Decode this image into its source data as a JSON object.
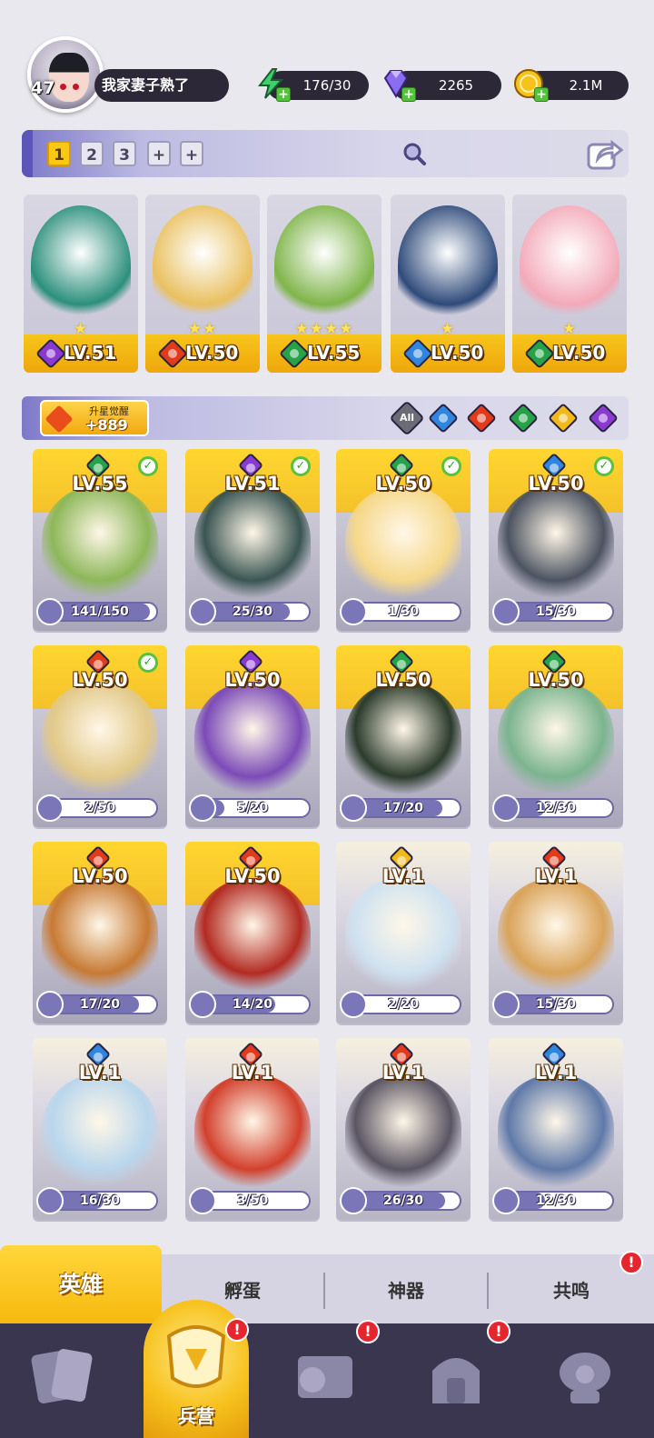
{
  "player": {
    "level": "47",
    "name": "我家妻子熟了"
  },
  "resources": {
    "energy": "176/30",
    "gems": "2265",
    "gold": "2.1M"
  },
  "team_tabs": [
    "1",
    "2",
    "3",
    "+",
    "+"
  ],
  "team": [
    {
      "level": "LV.51",
      "element": "dark",
      "stars": "★",
      "color": "#2b8f7c"
    },
    {
      "level": "LV.50",
      "element": "fire",
      "stars": "★★",
      "color": "#e9c060"
    },
    {
      "level": "LV.55",
      "element": "wind",
      "stars": "★★★★",
      "color": "#7fb54a"
    },
    {
      "level": "LV.50",
      "element": "water",
      "stars": "★",
      "color": "#2e4a7a"
    },
    {
      "level": "LV.50",
      "element": "wind",
      "stars": "★",
      "color": "#f3a9b8"
    }
  ],
  "awaken": {
    "title": "升星觉醒",
    "count": "+889"
  },
  "filter": {
    "all_label": "All",
    "elements": [
      "water",
      "fire",
      "wind",
      "light",
      "dark"
    ]
  },
  "heroes": [
    {
      "level": "LV.55",
      "element": "wind",
      "check": true,
      "progress": "141/150",
      "fill": 0.94,
      "color": "#8db759"
    },
    {
      "level": "LV.51",
      "element": "dark",
      "check": true,
      "progress": "25/30",
      "fill": 0.83,
      "color": "#3a5552"
    },
    {
      "level": "LV.50",
      "element": "wind",
      "check": true,
      "progress": "1/30",
      "fill": 0.03,
      "color": "#f6d88a"
    },
    {
      "level": "LV.50",
      "element": "water",
      "check": true,
      "progress": "15/30",
      "fill": 0.5,
      "color": "#4c5361"
    },
    {
      "level": "LV.50",
      "element": "fire",
      "check": true,
      "progress": "2/50",
      "fill": 0.04,
      "color": "#e2c989"
    },
    {
      "level": "LV.50",
      "element": "dark",
      "check": false,
      "progress": "5/20",
      "fill": 0.25,
      "color": "#7c4bb7"
    },
    {
      "level": "LV.50",
      "element": "wind",
      "check": false,
      "progress": "17/20",
      "fill": 0.85,
      "color": "#2b3b2c"
    },
    {
      "level": "LV.50",
      "element": "wind",
      "check": false,
      "progress": "12/30",
      "fill": 0.4,
      "color": "#7bb48e"
    },
    {
      "level": "LV.50",
      "element": "fire",
      "check": false,
      "progress": "17/20",
      "fill": 0.85,
      "color": "#c77a34"
    },
    {
      "level": "LV.50",
      "element": "fire",
      "check": false,
      "progress": "14/20",
      "fill": 0.7,
      "color": "#b32b22"
    },
    {
      "level": "LV.1",
      "element": "light",
      "check": false,
      "progress": "2/20",
      "fill": 0.1,
      "color": "#cfe2f0",
      "greyed": true
    },
    {
      "level": "LV.1",
      "element": "fire",
      "check": false,
      "progress": "15/30",
      "fill": 0.5,
      "color": "#d9a35a",
      "greyed": true
    },
    {
      "level": "LV.1",
      "element": "water",
      "check": false,
      "progress": "16/30",
      "fill": 0.53,
      "color": "#b9d6ec",
      "greyed": true
    },
    {
      "level": "LV.1",
      "element": "fire",
      "check": false,
      "progress": "3/50",
      "fill": 0.06,
      "color": "#d2402c",
      "greyed": true
    },
    {
      "level": "LV.1",
      "element": "fire",
      "check": false,
      "progress": "26/30",
      "fill": 0.87,
      "color": "#5a5563",
      "greyed": true
    },
    {
      "level": "LV.1",
      "element": "water",
      "check": false,
      "progress": "12/30",
      "fill": 0.4,
      "color": "#5f79a8",
      "greyed": true
    }
  ],
  "tabs": {
    "heroes": "英雄",
    "hatch": "孵蛋",
    "artifact": "神器",
    "resonance": "共鸣",
    "badge": "!"
  },
  "nav": {
    "barracks": "兵营",
    "badge": "!"
  }
}
